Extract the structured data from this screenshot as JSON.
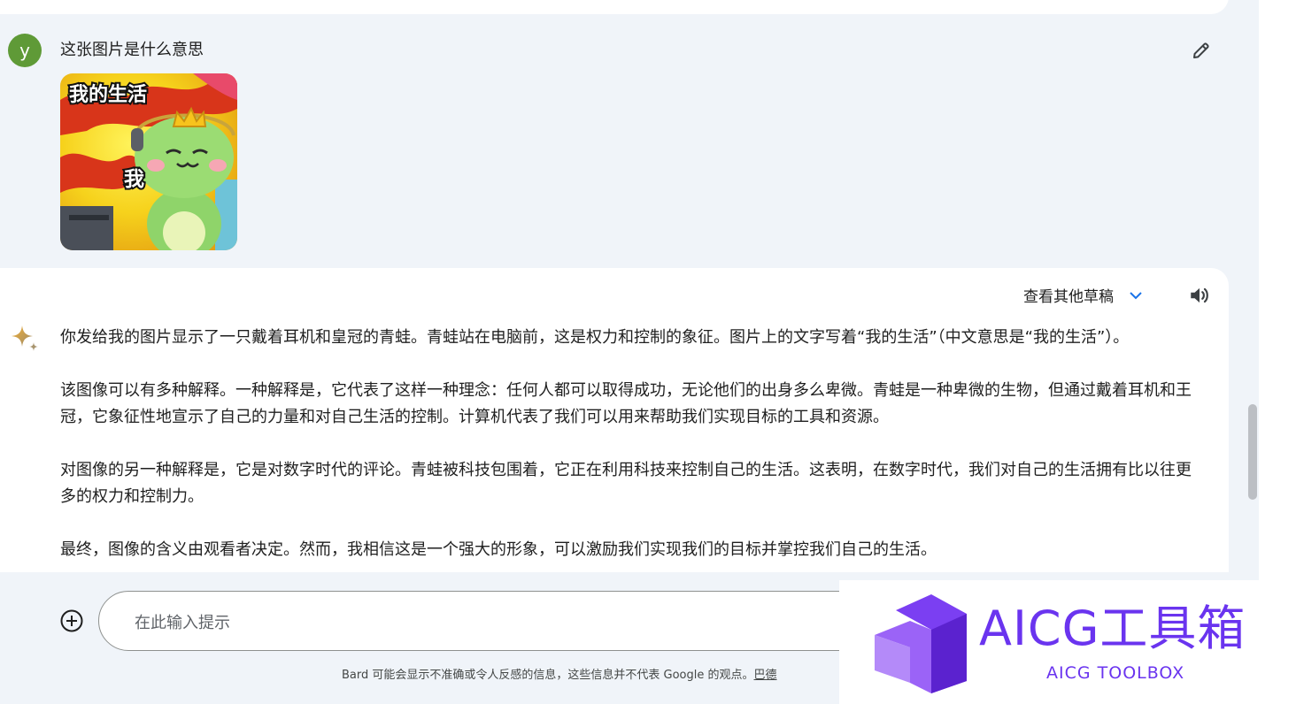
{
  "conversation": {
    "user": {
      "avatar_letter": "y",
      "avatar_color": "#5f9a37",
      "prompt": "这张图片是什么意思",
      "image": {
        "caption_top": "我的生活",
        "caption_mid": "我"
      }
    },
    "response": {
      "drafts_label": "查看其他草稿",
      "paragraphs": [
        "你发给我的图片显示了一只戴着耳机和皇冠的青蛙。青蛙站在电脑前，这是权力和控制的象征。图片上的文字写着“我的生活”（中文意思是“我的生活”）。",
        "该图像可以有多种解释。一种解释是，它代表了这样一种理念：任何人都可以取得成功，无论他们的出身多么卑微。青蛙是一种卑微的生物，但通过戴着耳机和王冠，它象征性地宣示了自己的力量和对自己生活的控制。计算机代表了我们可以用来帮助我们实现目标的工具和资源。",
        "对图像的另一种解释是，它是对数字时代的评论。青蛙被科技包围着，它正在利用科技来控制自己的生活。这表明，在数字时代，我们对自己的生活拥有比以往更多的权力和控制力。",
        "最终，图像的含义由观看者决定。然而，我相信这是一个强大的形象，可以激励我们实现我们的目标并掌控我们自己的生活。"
      ]
    }
  },
  "composer": {
    "placeholder": "在此输入提示",
    "disclaimer": "Bard 可能会显示不准确或令人反感的信息，这些信息并不代表 Google 的观点。",
    "disclaimer_link": "巴德"
  },
  "watermark": {
    "title": "AICG工具箱",
    "subtitle": "AICG TOOLBOX"
  },
  "colors": {
    "background": "#f0f4f9",
    "card": "#ffffff",
    "accent": "#6a34ef"
  }
}
